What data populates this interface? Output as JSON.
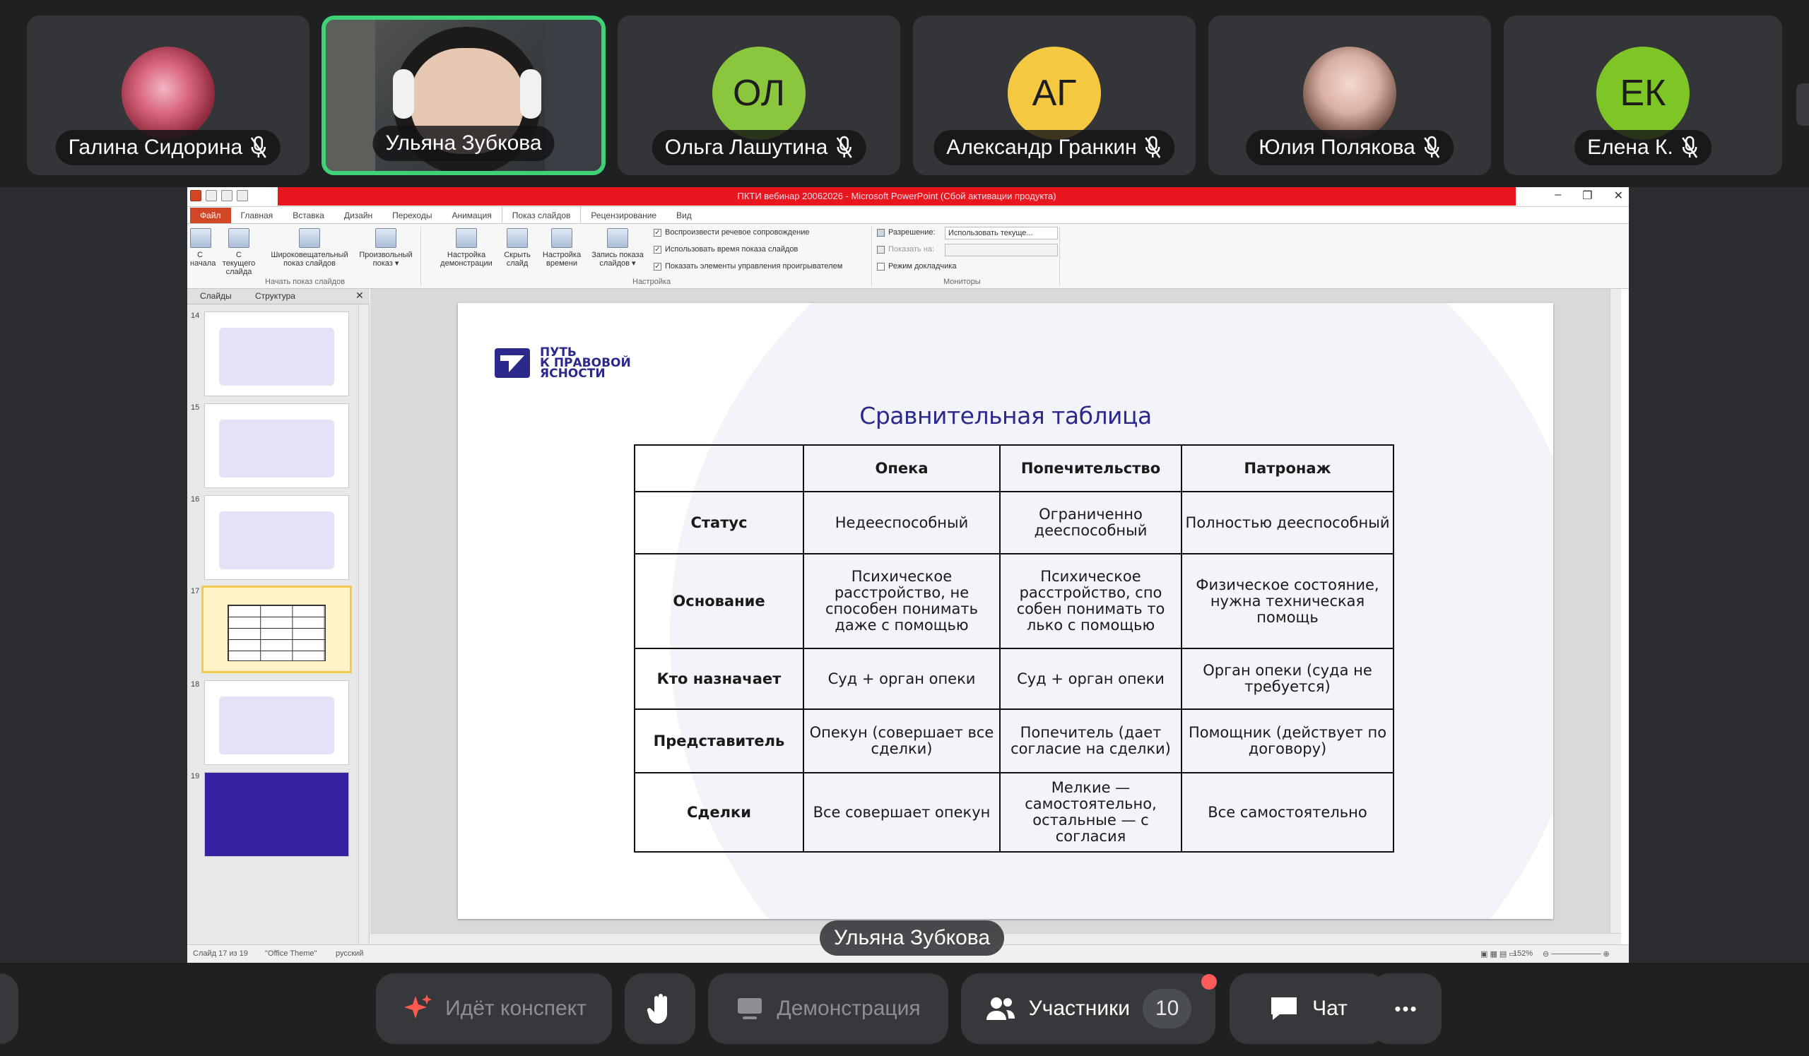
{
  "participants": [
    {
      "name": "Галина Сидорина",
      "initials": "",
      "avatar": "rose-photo",
      "color": "#c9a0a8"
    },
    {
      "name": "Ульяна Зубкова",
      "initials": "",
      "avatar": "camera-video",
      "color": "#444"
    },
    {
      "name": "Ольга Лашутина",
      "initials": "ОЛ",
      "avatar": "initials",
      "color": "#8bc73d"
    },
    {
      "name": "Александр Гранкин",
      "initials": "АГ",
      "avatar": "initials",
      "color": "#f5c842"
    },
    {
      "name": "Юлия Полякова",
      "initials": "",
      "avatar": "user-photo",
      "color": "#c9a7a0"
    },
    {
      "name": "Елена К.",
      "initials": "ЕК",
      "avatar": "initials",
      "color": "#7ec625"
    }
  ],
  "ppt": {
    "title": "ПКТИ вебинар 20062026 - Microsoft PowerPoint (Сбой активации продукта)",
    "tabs": [
      "Файл",
      "Главная",
      "Вставка",
      "Дизайн",
      "Переходы",
      "Анимация",
      "Показ слайдов",
      "Рецензирование",
      "Вид"
    ],
    "active_tab": "Показ слайдов",
    "ribbon": {
      "buttons": [
        {
          "l1": "С",
          "l2": "начала"
        },
        {
          "l1": "С текущего",
          "l2": "слайда"
        },
        {
          "l1": "Широковещательный",
          "l2": "показ слайдов"
        },
        {
          "l1": "Произвольный",
          "l2": "показ ▾"
        },
        {
          "l1": "Настройка",
          "l2": "демонстрации"
        },
        {
          "l1": "Скрыть",
          "l2": "слайд"
        },
        {
          "l1": "Настройка",
          "l2": "времени"
        },
        {
          "l1": "Запись показа",
          "l2": "слайдов ▾"
        }
      ],
      "group_start": "Начать показ слайдов",
      "group_setup": "Настройка",
      "group_monitors": "Мониторы",
      "checks": [
        {
          "label": "Воспроизвести речевое сопровождение",
          "checked": true
        },
        {
          "label": "Использовать время показа слайдов",
          "checked": true
        },
        {
          "label": "Показать элементы управления проигрывателем",
          "checked": true
        }
      ],
      "resolution_label": "Разрешение:",
      "resolution_value": "Использовать текуще...",
      "show_on_label": "Показать на:",
      "presenter_label": "Режим докладчика"
    },
    "pane_tabs": [
      "Слайды",
      "Структура"
    ],
    "thumbs": [
      {
        "num": "14"
      },
      {
        "num": "15"
      },
      {
        "num": "16"
      },
      {
        "num": "17"
      },
      {
        "num": "18"
      },
      {
        "num": "19"
      }
    ],
    "selected_thumb": "17",
    "status": {
      "slide": "Слайд 17 из 19",
      "theme": "\"Office Theme\"",
      "lang": "русский",
      "zoom": "152%"
    }
  },
  "slide": {
    "logo_lines": [
      "ПУТЬ",
      "К ПРАВОВОЙ",
      "ЯСНОСТИ"
    ],
    "title": "Сравнительная таблица",
    "columns": [
      "",
      "Опека",
      "Попечительство",
      "Патронаж"
    ],
    "rows": [
      {
        "head": "Статус",
        "cells": [
          "Недееспособный",
          "Ограниченно дееспособный",
          "Полностью дееспособный"
        ]
      },
      {
        "head": "Основание",
        "cells": [
          "Психическое расстройство, не способен понимать даже с помощью",
          "Психическое расстройство, спо собен понимать то лько с помощью",
          "Физическое состояние, нужна техническая помощь"
        ]
      },
      {
        "head": "Кто назначает",
        "cells": [
          "Суд + орган опеки",
          "Суд + орган опеки",
          "Орган опеки (суда не требуется)"
        ]
      },
      {
        "head": "Представитель",
        "cells": [
          "Опекун (совершает все сделки)",
          "Попечитель (дает согласие на сделки)",
          "Помощник (действует по договору)"
        ]
      },
      {
        "head": "Сделки",
        "cells": [
          "Все совершает опекун",
          "Мелкие — самостоятельно, остальные — с согласия",
          "Все самостоятельно"
        ]
      }
    ]
  },
  "speaker_label": "Ульяна Зубкова",
  "controls": {
    "summary": "Идёт конспект",
    "demo": "Демонстрация",
    "participants": "Участники",
    "participants_count": "10",
    "chat": "Чат",
    "more": "•••"
  }
}
